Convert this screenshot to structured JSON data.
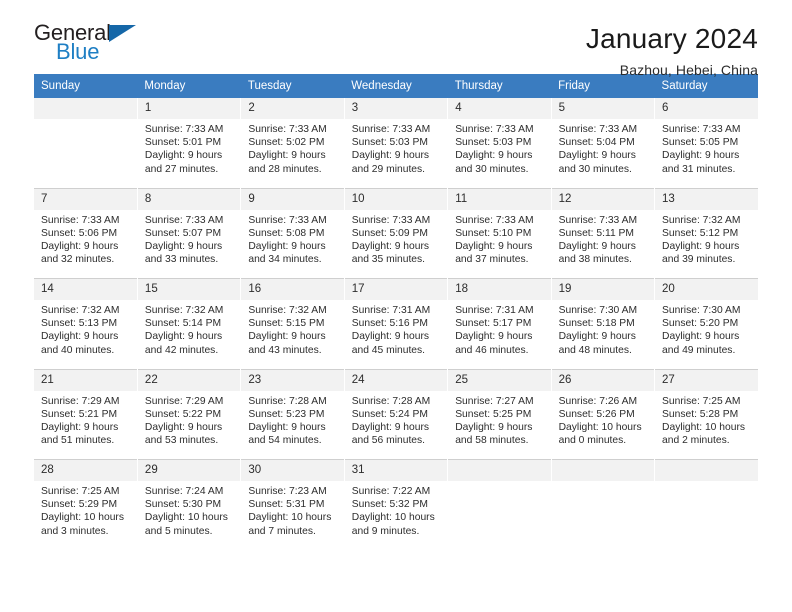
{
  "brand": {
    "name_top": "General",
    "name_bottom": "Blue",
    "triangle_color": "#1567a8",
    "blue_color": "#1f7fc4"
  },
  "header": {
    "title": "January 2024",
    "subtitle": "Bazhou, Hebei, China"
  },
  "theme": {
    "header_bg": "#3a7cc0",
    "header_text": "#ffffff",
    "daynum_bg": "#f2f2f2",
    "daynum_bg_shaded": "#ebebeb",
    "cell_text": "#2d2d2d"
  },
  "weekdays": [
    "Sunday",
    "Monday",
    "Tuesday",
    "Wednesday",
    "Thursday",
    "Friday",
    "Saturday"
  ],
  "weeks": [
    [
      {
        "day": ""
      },
      {
        "day": "1",
        "sunrise": "Sunrise: 7:33 AM",
        "sunset": "Sunset: 5:01 PM",
        "daylight1": "Daylight: 9 hours",
        "daylight2": "and 27 minutes."
      },
      {
        "day": "2",
        "sunrise": "Sunrise: 7:33 AM",
        "sunset": "Sunset: 5:02 PM",
        "daylight1": "Daylight: 9 hours",
        "daylight2": "and 28 minutes."
      },
      {
        "day": "3",
        "sunrise": "Sunrise: 7:33 AM",
        "sunset": "Sunset: 5:03 PM",
        "daylight1": "Daylight: 9 hours",
        "daylight2": "and 29 minutes."
      },
      {
        "day": "4",
        "sunrise": "Sunrise: 7:33 AM",
        "sunset": "Sunset: 5:03 PM",
        "daylight1": "Daylight: 9 hours",
        "daylight2": "and 30 minutes."
      },
      {
        "day": "5",
        "sunrise": "Sunrise: 7:33 AM",
        "sunset": "Sunset: 5:04 PM",
        "daylight1": "Daylight: 9 hours",
        "daylight2": "and 30 minutes."
      },
      {
        "day": "6",
        "sunrise": "Sunrise: 7:33 AM",
        "sunset": "Sunset: 5:05 PM",
        "daylight1": "Daylight: 9 hours",
        "daylight2": "and 31 minutes."
      }
    ],
    [
      {
        "day": "7",
        "sunrise": "Sunrise: 7:33 AM",
        "sunset": "Sunset: 5:06 PM",
        "daylight1": "Daylight: 9 hours",
        "daylight2": "and 32 minutes."
      },
      {
        "day": "8",
        "sunrise": "Sunrise: 7:33 AM",
        "sunset": "Sunset: 5:07 PM",
        "daylight1": "Daylight: 9 hours",
        "daylight2": "and 33 minutes."
      },
      {
        "day": "9",
        "sunrise": "Sunrise: 7:33 AM",
        "sunset": "Sunset: 5:08 PM",
        "daylight1": "Daylight: 9 hours",
        "daylight2": "and 34 minutes."
      },
      {
        "day": "10",
        "sunrise": "Sunrise: 7:33 AM",
        "sunset": "Sunset: 5:09 PM",
        "daylight1": "Daylight: 9 hours",
        "daylight2": "and 35 minutes."
      },
      {
        "day": "11",
        "sunrise": "Sunrise: 7:33 AM",
        "sunset": "Sunset: 5:10 PM",
        "daylight1": "Daylight: 9 hours",
        "daylight2": "and 37 minutes."
      },
      {
        "day": "12",
        "sunrise": "Sunrise: 7:33 AM",
        "sunset": "Sunset: 5:11 PM",
        "daylight1": "Daylight: 9 hours",
        "daylight2": "and 38 minutes."
      },
      {
        "day": "13",
        "sunrise": "Sunrise: 7:32 AM",
        "sunset": "Sunset: 5:12 PM",
        "daylight1": "Daylight: 9 hours",
        "daylight2": "and 39 minutes."
      }
    ],
    [
      {
        "day": "14",
        "sunrise": "Sunrise: 7:32 AM",
        "sunset": "Sunset: 5:13 PM",
        "daylight1": "Daylight: 9 hours",
        "daylight2": "and 40 minutes."
      },
      {
        "day": "15",
        "sunrise": "Sunrise: 7:32 AM",
        "sunset": "Sunset: 5:14 PM",
        "daylight1": "Daylight: 9 hours",
        "daylight2": "and 42 minutes."
      },
      {
        "day": "16",
        "sunrise": "Sunrise: 7:32 AM",
        "sunset": "Sunset: 5:15 PM",
        "daylight1": "Daylight: 9 hours",
        "daylight2": "and 43 minutes."
      },
      {
        "day": "17",
        "sunrise": "Sunrise: 7:31 AM",
        "sunset": "Sunset: 5:16 PM",
        "daylight1": "Daylight: 9 hours",
        "daylight2": "and 45 minutes."
      },
      {
        "day": "18",
        "sunrise": "Sunrise: 7:31 AM",
        "sunset": "Sunset: 5:17 PM",
        "daylight1": "Daylight: 9 hours",
        "daylight2": "and 46 minutes."
      },
      {
        "day": "19",
        "sunrise": "Sunrise: 7:30 AM",
        "sunset": "Sunset: 5:18 PM",
        "daylight1": "Daylight: 9 hours",
        "daylight2": "and 48 minutes."
      },
      {
        "day": "20",
        "sunrise": "Sunrise: 7:30 AM",
        "sunset": "Sunset: 5:20 PM",
        "daylight1": "Daylight: 9 hours",
        "daylight2": "and 49 minutes."
      }
    ],
    [
      {
        "day": "21",
        "sunrise": "Sunrise: 7:29 AM",
        "sunset": "Sunset: 5:21 PM",
        "daylight1": "Daylight: 9 hours",
        "daylight2": "and 51 minutes."
      },
      {
        "day": "22",
        "sunrise": "Sunrise: 7:29 AM",
        "sunset": "Sunset: 5:22 PM",
        "daylight1": "Daylight: 9 hours",
        "daylight2": "and 53 minutes."
      },
      {
        "day": "23",
        "sunrise": "Sunrise: 7:28 AM",
        "sunset": "Sunset: 5:23 PM",
        "daylight1": "Daylight: 9 hours",
        "daylight2": "and 54 minutes."
      },
      {
        "day": "24",
        "sunrise": "Sunrise: 7:28 AM",
        "sunset": "Sunset: 5:24 PM",
        "daylight1": "Daylight: 9 hours",
        "daylight2": "and 56 minutes."
      },
      {
        "day": "25",
        "sunrise": "Sunrise: 7:27 AM",
        "sunset": "Sunset: 5:25 PM",
        "daylight1": "Daylight: 9 hours",
        "daylight2": "and 58 minutes."
      },
      {
        "day": "26",
        "sunrise": "Sunrise: 7:26 AM",
        "sunset": "Sunset: 5:26 PM",
        "daylight1": "Daylight: 10 hours",
        "daylight2": "and 0 minutes."
      },
      {
        "day": "27",
        "sunrise": "Sunrise: 7:25 AM",
        "sunset": "Sunset: 5:28 PM",
        "daylight1": "Daylight: 10 hours",
        "daylight2": "and 2 minutes."
      }
    ],
    [
      {
        "day": "28",
        "sunrise": "Sunrise: 7:25 AM",
        "sunset": "Sunset: 5:29 PM",
        "daylight1": "Daylight: 10 hours",
        "daylight2": "and 3 minutes."
      },
      {
        "day": "29",
        "sunrise": "Sunrise: 7:24 AM",
        "sunset": "Sunset: 5:30 PM",
        "daylight1": "Daylight: 10 hours",
        "daylight2": "and 5 minutes."
      },
      {
        "day": "30",
        "sunrise": "Sunrise: 7:23 AM",
        "sunset": "Sunset: 5:31 PM",
        "daylight1": "Daylight: 10 hours",
        "daylight2": "and 7 minutes."
      },
      {
        "day": "31",
        "sunrise": "Sunrise: 7:22 AM",
        "sunset": "Sunset: 5:32 PM",
        "daylight1": "Daylight: 10 hours",
        "daylight2": "and 9 minutes."
      },
      {
        "day": ""
      },
      {
        "day": ""
      },
      {
        "day": ""
      }
    ]
  ]
}
